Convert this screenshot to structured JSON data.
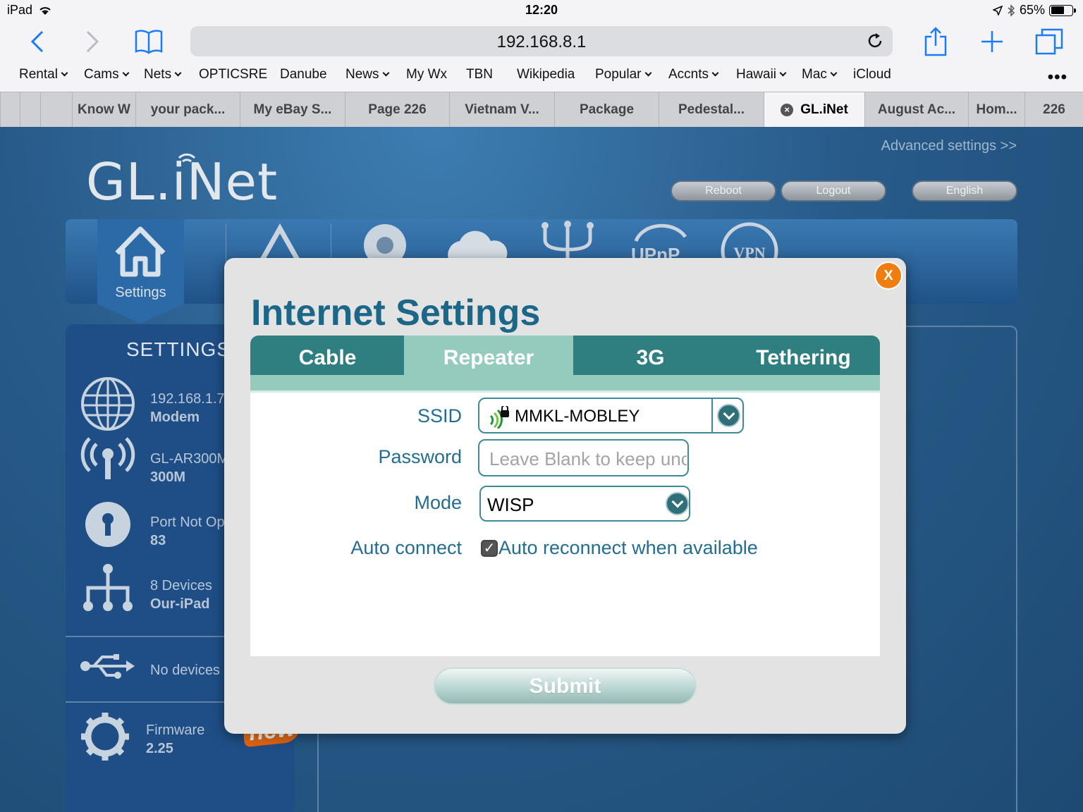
{
  "status_bar": {
    "device": "iPad",
    "time": "12:20",
    "battery": "65%",
    "battery_level": 0.65
  },
  "browser": {
    "url": "192.168.8.1",
    "bookmarks": [
      "Rental",
      "Cams",
      "Nets",
      "OPTICSRE",
      "Danube",
      "News",
      "My Wx",
      "TBN",
      "Wikipedia",
      "Popular",
      "Accnts",
      "Hawaii",
      "Mac",
      "iCloud"
    ],
    "more": "•••",
    "tabs": [
      "Know W",
      "your pack...",
      "My eBay S...",
      "Page 226",
      "Vietnam V...",
      "Package",
      "Pedestal...",
      "GL.iNet",
      "August Ac...",
      "Hom...",
      "226"
    ],
    "active_tab": "GL.iNet",
    "tab_close": "×"
  },
  "router": {
    "advanced_link": "Advanced settings >>",
    "logo": "GL.iNet",
    "buttons": {
      "reboot": "Reboot",
      "logout": "Logout",
      "language": "English"
    },
    "iconbar": {
      "home_label": "Settings",
      "upnp": "UPnP",
      "vpn": "VPN"
    },
    "left_panel": {
      "title": "SETTINGS",
      "rows": [
        {
          "line1": "192.168.1.7",
          "line2": "Modem"
        },
        {
          "line1": "GL-AR300M",
          "line2": "300M"
        },
        {
          "line1": "Port Not Op",
          "line2": "83"
        },
        {
          "line1": "8 Devices",
          "line2": "Our-iPad"
        },
        {
          "line1": "No devices"
        },
        {
          "line1": "Firmware",
          "line2": "2.25"
        }
      ],
      "badge": "new"
    }
  },
  "modal": {
    "close": "X",
    "title": "Internet Settings",
    "tabs": [
      "Cable",
      "Repeater",
      "3G",
      "Tethering"
    ],
    "active_tab": "Repeater",
    "form": {
      "ssid_label": "SSID",
      "ssid_value": "MMKL-MOBLEY",
      "password_label": "Password",
      "password_placeholder": "Leave Blank to keep unchanged",
      "mode_label": "Mode",
      "mode_value": "WISP",
      "auto_label": "Auto connect",
      "auto_text": "Auto reconnect when available",
      "auto_checked": true,
      "check_mark": "✓"
    },
    "submit": "Submit"
  },
  "colors": {
    "title": "#1c6787",
    "tab": "#2f7f80",
    "tab_active": "#94cbbd",
    "close": "#f07d0f",
    "label": "#226e91"
  }
}
